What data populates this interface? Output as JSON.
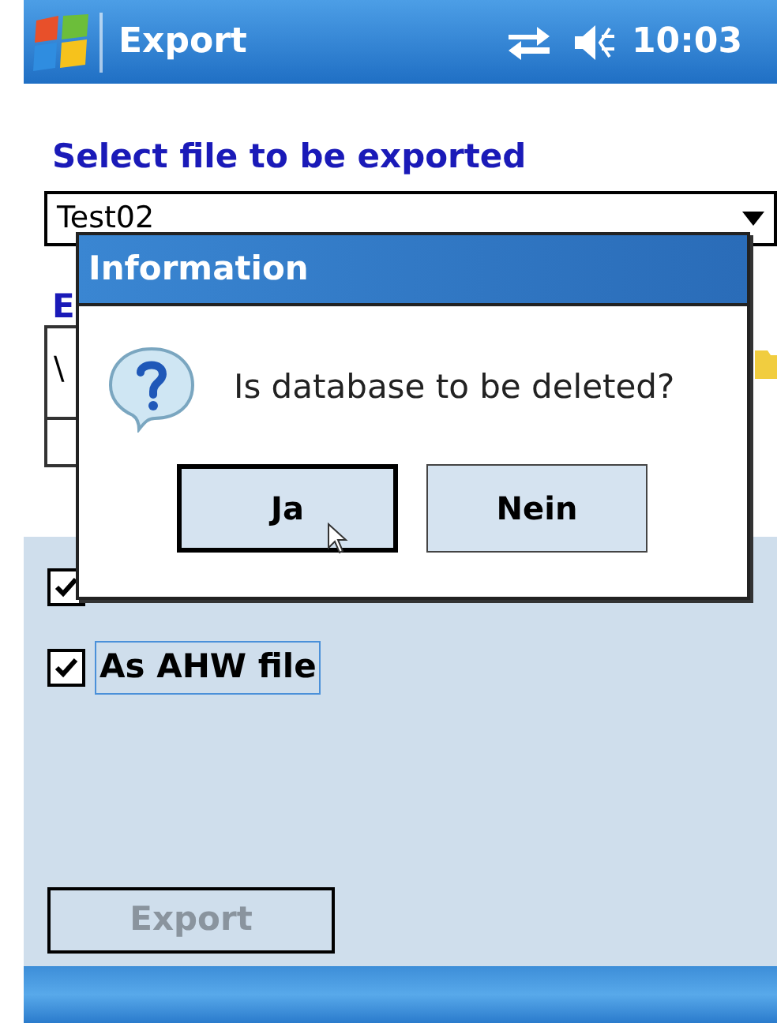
{
  "status_bar": {
    "title": "Export",
    "time": "10:03"
  },
  "select_label": "Select file to be exported",
  "file_dropdown": {
    "value": "Test02"
  },
  "export_label": "E",
  "path_field": {
    "value": "\\"
  },
  "options": [
    {
      "checked": true
    },
    {
      "label": "As AHW file",
      "checked": true,
      "focused": true
    }
  ],
  "export_button": {
    "label": "Export",
    "disabled": true
  },
  "dialog": {
    "title": "Information",
    "message": "Is database to be deleted?",
    "buttons": [
      {
        "label": "Ja",
        "default": true
      },
      {
        "label": "Nein",
        "default": false
      }
    ]
  }
}
